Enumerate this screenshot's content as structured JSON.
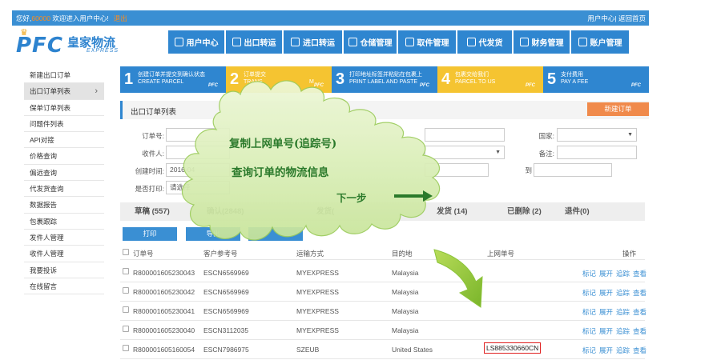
{
  "topbar": {
    "greeting_prefix": "您好,",
    "user_id": "60000",
    "greeting_suffix": " 欢迎进入用户中心!",
    "logout": "退出",
    "right_links": "用户中心| 返回首页"
  },
  "logo": {
    "letters": "PFC",
    "name_cn": "皇家物流",
    "name_en": "EXPRESS"
  },
  "main_nav": [
    {
      "label": "用户中心",
      "icon": "grid-icon"
    },
    {
      "label": "出口转运",
      "icon": "export-icon"
    },
    {
      "label": "进口转运",
      "icon": "import-icon"
    },
    {
      "label": "仓储管理",
      "icon": "warehouse-icon"
    },
    {
      "label": "取件管理",
      "icon": "pickup-icon"
    },
    {
      "label": "代发货",
      "icon": "warning-icon"
    },
    {
      "label": "财务管理",
      "icon": "dollar-icon"
    },
    {
      "label": "账户管理",
      "icon": "gear-icon"
    }
  ],
  "sidebar": [
    {
      "label": "新建出口订单"
    },
    {
      "label": "出口订单列表",
      "active": true
    },
    {
      "label": "保单订单列表"
    },
    {
      "label": "问题件列表"
    },
    {
      "label": "API对接"
    },
    {
      "label": "价格查询"
    },
    {
      "label": "偏远查询"
    },
    {
      "label": "代发货查询"
    },
    {
      "label": "数据报告"
    },
    {
      "label": "包裹跟踪"
    },
    {
      "label": "发件人管理"
    },
    {
      "label": "收件人管理"
    },
    {
      "label": "我要投诉"
    },
    {
      "label": "在线留言"
    }
  ],
  "steps": [
    {
      "num": "1",
      "cn": "创建订单并提交到确认状态",
      "en": "CREATE  PARCEL",
      "color": "#2f86d0",
      "logo": "PFC"
    },
    {
      "num": "2",
      "cn": "订单提交",
      "en": "TRANS",
      "extra": "M",
      "color": "#f5c431",
      "logo": "PFC"
    },
    {
      "num": "3",
      "cn": "打印地址标签并粘贴在包裹上",
      "en": "PRINT LABEL AND PASTE",
      "color": "#2f86d0",
      "logo": "PFC"
    },
    {
      "num": "4",
      "cn": "包裹交给我们",
      "en": "PARCEL TO US",
      "color": "#f5c431",
      "logo": "PFC"
    },
    {
      "num": "5",
      "cn": "支付费用",
      "en": "PAY A FEE",
      "color": "#2f86d0",
      "logo": "PFC"
    }
  ],
  "panel": {
    "title": "出口订单列表",
    "new_order": "新建订单"
  },
  "filters": {
    "order_no": "订单号:",
    "recipient": "收件人:",
    "created": "创建时间:",
    "created_value": "2016-04",
    "printed": "是否打印:",
    "printed_value": "请选择",
    "country": "国家:",
    "note": "备注:",
    "to": "到"
  },
  "tabs": [
    {
      "label": "草稿 (557)"
    },
    {
      "label": "确认(2848)"
    },
    {
      "label": "发货("
    },
    {
      "label": "发货 (14)"
    },
    {
      "label": "已删除 (2)"
    },
    {
      "label": "退件(0)"
    }
  ],
  "actions": {
    "print": "打印",
    "export": "导出"
  },
  "table": {
    "headers": [
      "订单号",
      "客户参考号",
      "运输方式",
      "目的地",
      "上网单号",
      "操作"
    ],
    "row_ops": [
      "标记",
      "展开",
      "追踪",
      "查看"
    ],
    "rows": [
      {
        "order_no": "R800001605230043",
        "ref": "ESCN6569969",
        "method": "MYEXPRESS",
        "dest": "Malaysia",
        "tracking": ""
      },
      {
        "order_no": "R800001605230042",
        "ref": "ESCN6569969",
        "method": "MYEXPRESS",
        "dest": "Malaysia",
        "tracking": ""
      },
      {
        "order_no": "R800001605230041",
        "ref": "ESCN6569969",
        "method": "MYEXPRESS",
        "dest": "Malaysia",
        "tracking": ""
      },
      {
        "order_no": "R800001605230040",
        "ref": "ESCN3112035",
        "method": "MYEXPRESS",
        "dest": "Malaysia",
        "tracking": ""
      },
      {
        "order_no": "R800001605160054",
        "ref": "ESCN7986975",
        "method": "SZEUB",
        "dest": "United States",
        "tracking": "LS885330660CN"
      }
    ]
  },
  "callout": {
    "line1": "复制上网单号(追踪号)",
    "line2": "查询订单的物流信息",
    "next": "下一步",
    "fill_color": "#d8f0b0",
    "text_color": "#2b7a2b"
  }
}
